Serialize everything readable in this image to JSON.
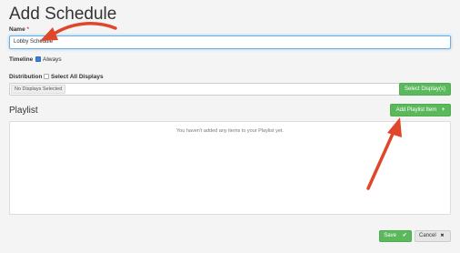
{
  "page": {
    "title": "Add Schedule"
  },
  "form": {
    "name_label": "Name",
    "required_mark": "*",
    "name_value": "Lobby Schedule",
    "timeline_label": "Timeline",
    "timeline_option": "Always",
    "distribution_label": "Distribution",
    "select_all_label": "Select All Displays",
    "displays_tag": "No Displays Selected",
    "select_displays_button": "Select Display(s)"
  },
  "playlist": {
    "heading": "Playlist",
    "add_button": "Add Playlist Item",
    "add_icon": "+",
    "empty_message": "You haven't added any items to your Playlist yet."
  },
  "footer": {
    "save_label": "Save",
    "save_icon": "✔",
    "cancel_label": "Cancel",
    "cancel_icon": "✖"
  },
  "colors": {
    "accent_green": "#5cb85c",
    "annotation_arrow": "#e0462a",
    "focus_blue": "#66afe9"
  }
}
